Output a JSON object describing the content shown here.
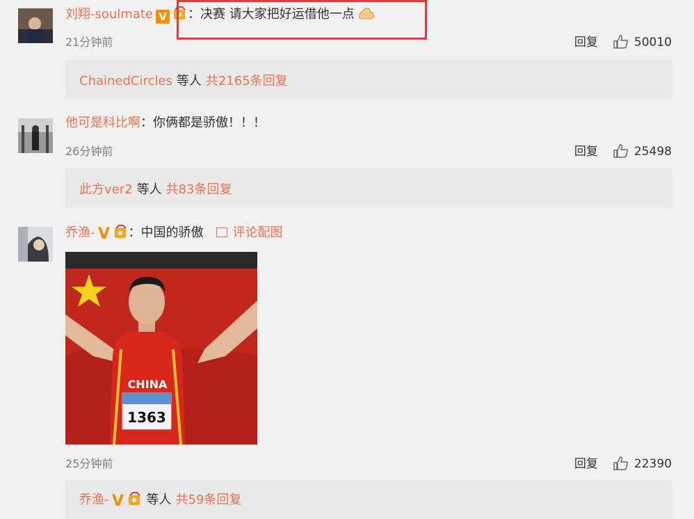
{
  "comments": [
    {
      "username": "刘翔-soulmate",
      "separator": "：",
      "text": "决赛 请大家把好运借他一点",
      "time": "21分钟前",
      "reply_label": "回复",
      "likes": "50010",
      "thread": {
        "users": "ChainedCircles",
        "mid": "等人",
        "count": "共2165条回复"
      }
    },
    {
      "username": "他可是科比啊",
      "separator": "：",
      "text": "你俩都是骄傲！！！",
      "time": "26分钟前",
      "reply_label": "回复",
      "likes": "25498",
      "thread": {
        "users": "此方ver2",
        "mid": "等人",
        "count": "共83条回复"
      }
    },
    {
      "username": "乔渔-",
      "separator": "：",
      "text": "中国的骄傲",
      "pic_label": "评论配图",
      "time": "25分钟前",
      "reply_label": "回复",
      "likes": "22390",
      "thread": {
        "users": "乔渔-",
        "mid": "等人",
        "count": "共59条回复"
      }
    }
  ],
  "photo": {
    "jersey_text": "CHINA",
    "bib_number": "1363"
  },
  "badges": {
    "v": "V"
  },
  "colors": {
    "username": "#eb7350",
    "highlight": "#e4393c",
    "background": "#f1f1f1",
    "thread_bg": "#e9e9e9"
  }
}
